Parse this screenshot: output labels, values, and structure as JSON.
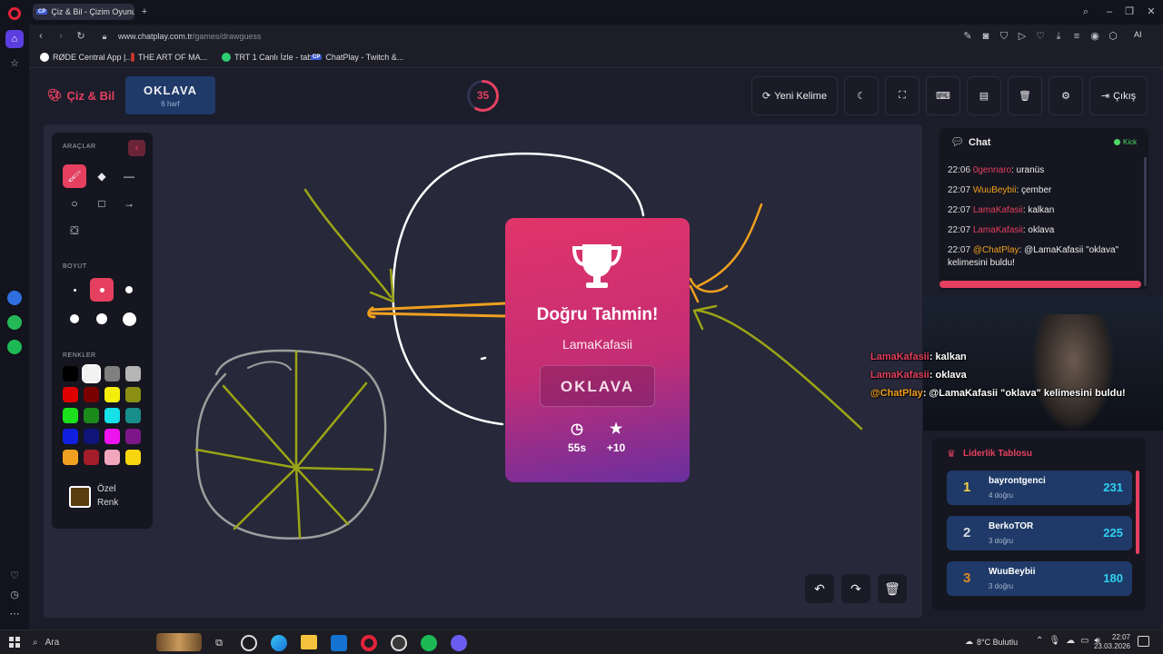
{
  "browser": {
    "tab_title": "Çiz & Bil - Çizim Oyunu",
    "tab_badge": "CP",
    "url_host": "www.chatplay.com.tr",
    "url_path": "/games/drawguess",
    "ai_label": "AI",
    "bookmarks": [
      "RØDE Central App |...",
      "THE ART OF MA...",
      "TRT 1 Canlı İzle - tabii",
      "ChatPlay - Twitch &..."
    ]
  },
  "header": {
    "app_name": "Çiz & Bil",
    "word": "OKLAVA",
    "word_hint": "6 harf",
    "timer": "35",
    "timer_fraction": 0.58,
    "new_word_label": "Yeni Kelime",
    "exit_label": "Çıkış"
  },
  "tools": {
    "tools_title": "ARAÇLAR",
    "size_title": "BOYUT",
    "colors_title": "RENKLER",
    "custom_color_label": "Özel Renk",
    "custom_color": "#5a3e0f",
    "palette": [
      "#000000",
      "#f2f2f2",
      "#808080",
      "#b5b5b5",
      "#e00000",
      "#7a0000",
      "#f5ee0c",
      "#8b8f14",
      "#1de01d",
      "#1b8a1b",
      "#16e0e8",
      "#178e8a",
      "#1120e0",
      "#0e1478",
      "#ee13ee",
      "#7d1689",
      "#f0a020",
      "#a31d2a",
      "#f2a6bd",
      "#f7d60f"
    ],
    "accent": "#e5405f"
  },
  "modal": {
    "title": "Doğru Tahmin!",
    "user": "LamaKafasii",
    "word": "OKLAVA",
    "time": "55s",
    "points": "+10"
  },
  "chat": {
    "title": "Chat",
    "kick_label": "Kick",
    "messages": [
      {
        "time": "22:06",
        "user": "0gennaro",
        "color": "#e5405f",
        "text": ": uranüs"
      },
      {
        "time": "22:07",
        "user": "WuuBeybii",
        "color": "#f0a020",
        "text": ": çember"
      },
      {
        "time": "22:07",
        "user": "LamaKafasii",
        "color": "#e5405f",
        "text": ": kalkan"
      },
      {
        "time": "22:07",
        "user": "LamaKafasii",
        "color": "#e5405f",
        "text": ": oklava"
      },
      {
        "time": "22:07",
        "user": "@ChatPlay",
        "color": "#f0a020",
        "text": ": @LamaKafasii \"oklava\" kelimesini buldu!"
      }
    ]
  },
  "overlay": {
    "lines": [
      {
        "user": "LamaKafasii",
        "text": ": kalkan"
      },
      {
        "user": "LamaKafasii",
        "text": ": oklava"
      },
      {
        "user": "@ChatPlay",
        "text": ": @LamaKafasii \"oklava\" kelimesini buldu!"
      }
    ]
  },
  "leaderboard": {
    "title": "Liderlik Tablosu",
    "rows": [
      {
        "rank": "1",
        "name": "bayrontgenci",
        "detail": "4 doğru",
        "score": "231",
        "color": "#f5d142"
      },
      {
        "rank": "2",
        "name": "BerkoTOR",
        "detail": "3 doğru",
        "score": "225",
        "color": "#d8d8e0"
      },
      {
        "rank": "3",
        "name": "WuuBeybii",
        "detail": "3 doğru",
        "score": "180",
        "color": "#e08a2a"
      }
    ]
  },
  "taskbar": {
    "search_label": "Ara",
    "weather": "8°C  Bulutlu",
    "time": "22:07",
    "date": "23.03.2026"
  }
}
